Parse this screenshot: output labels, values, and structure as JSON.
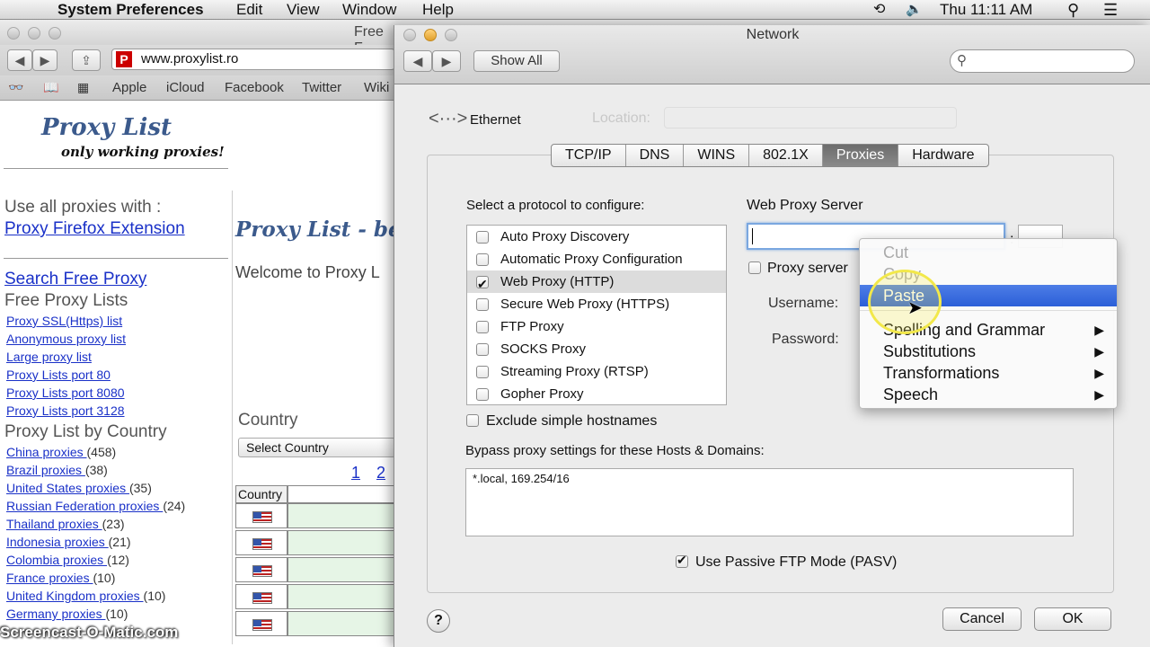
{
  "menubar": {
    "app": "System Preferences",
    "menus": [
      "Edit",
      "View",
      "Window",
      "Help"
    ],
    "clock": "Thu 11:11 AM"
  },
  "browser": {
    "title_fragment": "Free F",
    "url": "www.proxylist.ro",
    "bookmarks": [
      "Apple",
      "iCloud",
      "Facebook",
      "Twitter",
      "Wiki"
    ],
    "logo_title": "Proxy List",
    "logo_subtitle": "only working proxies!",
    "use_all": "Use all proxies with :",
    "firefox_ext": "Proxy Firefox Extension",
    "search_free": "Search Free Proxy",
    "free_lists": "Free Proxy Lists",
    "lists": [
      "Proxy SSL(Https) list",
      "Anonymous proxy list",
      "Large proxy list",
      "Proxy Lists port 80",
      "Proxy Lists port 8080",
      "Proxy Lists port 3128"
    ],
    "by_country_heading": "Proxy List by Country",
    "countries": [
      {
        "name": "China proxies ",
        "count": "(458)"
      },
      {
        "name": "Brazil proxies ",
        "count": "(38)"
      },
      {
        "name": "United States proxies ",
        "count": "(35)"
      },
      {
        "name": "Russian Federation proxies ",
        "count": "(24)"
      },
      {
        "name": "Thailand proxies ",
        "count": "(23)"
      },
      {
        "name": "Indonesia proxies ",
        "count": "(21)"
      },
      {
        "name": "Colombia proxies ",
        "count": "(12)"
      },
      {
        "name": "France proxies ",
        "count": "(10)"
      },
      {
        "name": "United Kingdom proxies ",
        "count": "(10)"
      },
      {
        "name": "Germany proxies ",
        "count": "(10)"
      }
    ],
    "main_title": "Proxy List - be",
    "welcome": "Welcome to Proxy L",
    "country_label": "Country",
    "select_country": "Select Country",
    "pages": [
      "1",
      "2"
    ],
    "table_header": "Country"
  },
  "network": {
    "title": "Network",
    "show_all": "Show All",
    "interface": "Ethernet",
    "tabs": [
      "TCP/IP",
      "DNS",
      "WINS",
      "802.1X",
      "Proxies",
      "Hardware"
    ],
    "selected_tab": "Proxies",
    "protocol_heading": "Select a protocol to configure:",
    "protocols": [
      {
        "label": "Auto Proxy Discovery",
        "checked": false
      },
      {
        "label": "Automatic Proxy Configuration",
        "checked": false
      },
      {
        "label": "Web Proxy (HTTP)",
        "checked": true
      },
      {
        "label": "Secure Web Proxy (HTTPS)",
        "checked": false
      },
      {
        "label": "FTP Proxy",
        "checked": false
      },
      {
        "label": "SOCKS Proxy",
        "checked": false
      },
      {
        "label": "Streaming Proxy (RTSP)",
        "checked": false
      },
      {
        "label": "Gopher Proxy",
        "checked": false
      }
    ],
    "web_proxy_server": "Web Proxy Server",
    "proxy_server_requires": "Proxy server",
    "username_label": "Username:",
    "password_label": "Password:",
    "exclude_simple": "Exclude simple hostnames",
    "bypass_label": "Bypass proxy settings for these Hosts & Domains:",
    "bypass_value": "*.local, 169.254/16",
    "passive_ftp": "Use Passive FTP Mode (PASV)",
    "cancel": "Cancel",
    "ok": "OK",
    "help": "?"
  },
  "context_menu": {
    "items": [
      {
        "label": "Cut",
        "state": "disabled"
      },
      {
        "label": "Copy",
        "state": "disabled"
      },
      {
        "label": "Paste",
        "state": "highlighted"
      },
      {
        "label": "Spelling and Grammar",
        "submenu": true
      },
      {
        "label": "Substitutions",
        "submenu": true
      },
      {
        "label": "Transformations",
        "submenu": true
      },
      {
        "label": "Speech",
        "submenu": true
      }
    ]
  },
  "watermark": "Screencast-O-Matic.com",
  "colors": {
    "menu_highlight": "#2b5fd8",
    "link": "#1a31c8",
    "logo": "#3b5a8c"
  }
}
